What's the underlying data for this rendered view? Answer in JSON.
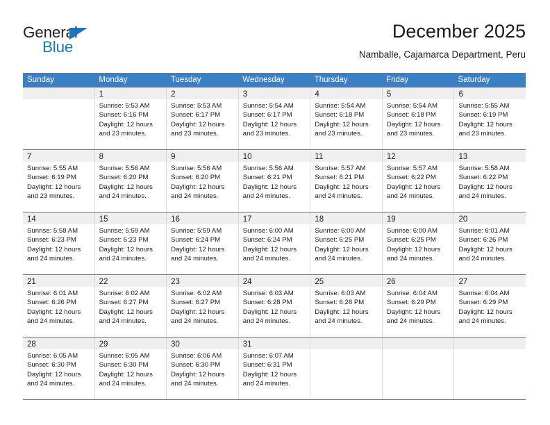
{
  "brand": {
    "name_part1": "General",
    "name_part2": "Blue",
    "triangle_color": "#1b75bb"
  },
  "header": {
    "title": "December 2025",
    "subtitle": "Namballe, Cajamarca Department, Peru"
  },
  "calendar": {
    "header_bg": "#3b7fc4",
    "daynum_bg": "#efefef",
    "weekdays": [
      "Sunday",
      "Monday",
      "Tuesday",
      "Wednesday",
      "Thursday",
      "Friday",
      "Saturday"
    ],
    "weeks": [
      [
        {
          "day": "",
          "sunrise": "",
          "sunset": "",
          "daylight1": "",
          "daylight2": ""
        },
        {
          "day": "1",
          "sunrise": "Sunrise: 5:53 AM",
          "sunset": "Sunset: 6:16 PM",
          "daylight1": "Daylight: 12 hours",
          "daylight2": "and 23 minutes."
        },
        {
          "day": "2",
          "sunrise": "Sunrise: 5:53 AM",
          "sunset": "Sunset: 6:17 PM",
          "daylight1": "Daylight: 12 hours",
          "daylight2": "and 23 minutes."
        },
        {
          "day": "3",
          "sunrise": "Sunrise: 5:54 AM",
          "sunset": "Sunset: 6:17 PM",
          "daylight1": "Daylight: 12 hours",
          "daylight2": "and 23 minutes."
        },
        {
          "day": "4",
          "sunrise": "Sunrise: 5:54 AM",
          "sunset": "Sunset: 6:18 PM",
          "daylight1": "Daylight: 12 hours",
          "daylight2": "and 23 minutes."
        },
        {
          "day": "5",
          "sunrise": "Sunrise: 5:54 AM",
          "sunset": "Sunset: 6:18 PM",
          "daylight1": "Daylight: 12 hours",
          "daylight2": "and 23 minutes."
        },
        {
          "day": "6",
          "sunrise": "Sunrise: 5:55 AM",
          "sunset": "Sunset: 6:19 PM",
          "daylight1": "Daylight: 12 hours",
          "daylight2": "and 23 minutes."
        }
      ],
      [
        {
          "day": "7",
          "sunrise": "Sunrise: 5:55 AM",
          "sunset": "Sunset: 6:19 PM",
          "daylight1": "Daylight: 12 hours",
          "daylight2": "and 23 minutes."
        },
        {
          "day": "8",
          "sunrise": "Sunrise: 5:56 AM",
          "sunset": "Sunset: 6:20 PM",
          "daylight1": "Daylight: 12 hours",
          "daylight2": "and 24 minutes."
        },
        {
          "day": "9",
          "sunrise": "Sunrise: 5:56 AM",
          "sunset": "Sunset: 6:20 PM",
          "daylight1": "Daylight: 12 hours",
          "daylight2": "and 24 minutes."
        },
        {
          "day": "10",
          "sunrise": "Sunrise: 5:56 AM",
          "sunset": "Sunset: 6:21 PM",
          "daylight1": "Daylight: 12 hours",
          "daylight2": "and 24 minutes."
        },
        {
          "day": "11",
          "sunrise": "Sunrise: 5:57 AM",
          "sunset": "Sunset: 6:21 PM",
          "daylight1": "Daylight: 12 hours",
          "daylight2": "and 24 minutes."
        },
        {
          "day": "12",
          "sunrise": "Sunrise: 5:57 AM",
          "sunset": "Sunset: 6:22 PM",
          "daylight1": "Daylight: 12 hours",
          "daylight2": "and 24 minutes."
        },
        {
          "day": "13",
          "sunrise": "Sunrise: 5:58 AM",
          "sunset": "Sunset: 6:22 PM",
          "daylight1": "Daylight: 12 hours",
          "daylight2": "and 24 minutes."
        }
      ],
      [
        {
          "day": "14",
          "sunrise": "Sunrise: 5:58 AM",
          "sunset": "Sunset: 6:23 PM",
          "daylight1": "Daylight: 12 hours",
          "daylight2": "and 24 minutes."
        },
        {
          "day": "15",
          "sunrise": "Sunrise: 5:59 AM",
          "sunset": "Sunset: 6:23 PM",
          "daylight1": "Daylight: 12 hours",
          "daylight2": "and 24 minutes."
        },
        {
          "day": "16",
          "sunrise": "Sunrise: 5:59 AM",
          "sunset": "Sunset: 6:24 PM",
          "daylight1": "Daylight: 12 hours",
          "daylight2": "and 24 minutes."
        },
        {
          "day": "17",
          "sunrise": "Sunrise: 6:00 AM",
          "sunset": "Sunset: 6:24 PM",
          "daylight1": "Daylight: 12 hours",
          "daylight2": "and 24 minutes."
        },
        {
          "day": "18",
          "sunrise": "Sunrise: 6:00 AM",
          "sunset": "Sunset: 6:25 PM",
          "daylight1": "Daylight: 12 hours",
          "daylight2": "and 24 minutes."
        },
        {
          "day": "19",
          "sunrise": "Sunrise: 6:00 AM",
          "sunset": "Sunset: 6:25 PM",
          "daylight1": "Daylight: 12 hours",
          "daylight2": "and 24 minutes."
        },
        {
          "day": "20",
          "sunrise": "Sunrise: 6:01 AM",
          "sunset": "Sunset: 6:26 PM",
          "daylight1": "Daylight: 12 hours",
          "daylight2": "and 24 minutes."
        }
      ],
      [
        {
          "day": "21",
          "sunrise": "Sunrise: 6:01 AM",
          "sunset": "Sunset: 6:26 PM",
          "daylight1": "Daylight: 12 hours",
          "daylight2": "and 24 minutes."
        },
        {
          "day": "22",
          "sunrise": "Sunrise: 6:02 AM",
          "sunset": "Sunset: 6:27 PM",
          "daylight1": "Daylight: 12 hours",
          "daylight2": "and 24 minutes."
        },
        {
          "day": "23",
          "sunrise": "Sunrise: 6:02 AM",
          "sunset": "Sunset: 6:27 PM",
          "daylight1": "Daylight: 12 hours",
          "daylight2": "and 24 minutes."
        },
        {
          "day": "24",
          "sunrise": "Sunrise: 6:03 AM",
          "sunset": "Sunset: 6:28 PM",
          "daylight1": "Daylight: 12 hours",
          "daylight2": "and 24 minutes."
        },
        {
          "day": "25",
          "sunrise": "Sunrise: 6:03 AM",
          "sunset": "Sunset: 6:28 PM",
          "daylight1": "Daylight: 12 hours",
          "daylight2": "and 24 minutes."
        },
        {
          "day": "26",
          "sunrise": "Sunrise: 6:04 AM",
          "sunset": "Sunset: 6:29 PM",
          "daylight1": "Daylight: 12 hours",
          "daylight2": "and 24 minutes."
        },
        {
          "day": "27",
          "sunrise": "Sunrise: 6:04 AM",
          "sunset": "Sunset: 6:29 PM",
          "daylight1": "Daylight: 12 hours",
          "daylight2": "and 24 minutes."
        }
      ],
      [
        {
          "day": "28",
          "sunrise": "Sunrise: 6:05 AM",
          "sunset": "Sunset: 6:30 PM",
          "daylight1": "Daylight: 12 hours",
          "daylight2": "and 24 minutes."
        },
        {
          "day": "29",
          "sunrise": "Sunrise: 6:05 AM",
          "sunset": "Sunset: 6:30 PM",
          "daylight1": "Daylight: 12 hours",
          "daylight2": "and 24 minutes."
        },
        {
          "day": "30",
          "sunrise": "Sunrise: 6:06 AM",
          "sunset": "Sunset: 6:30 PM",
          "daylight1": "Daylight: 12 hours",
          "daylight2": "and 24 minutes."
        },
        {
          "day": "31",
          "sunrise": "Sunrise: 6:07 AM",
          "sunset": "Sunset: 6:31 PM",
          "daylight1": "Daylight: 12 hours",
          "daylight2": "and 24 minutes."
        },
        {
          "day": "",
          "sunrise": "",
          "sunset": "",
          "daylight1": "",
          "daylight2": ""
        },
        {
          "day": "",
          "sunrise": "",
          "sunset": "",
          "daylight1": "",
          "daylight2": ""
        },
        {
          "day": "",
          "sunrise": "",
          "sunset": "",
          "daylight1": "",
          "daylight2": ""
        }
      ]
    ]
  }
}
